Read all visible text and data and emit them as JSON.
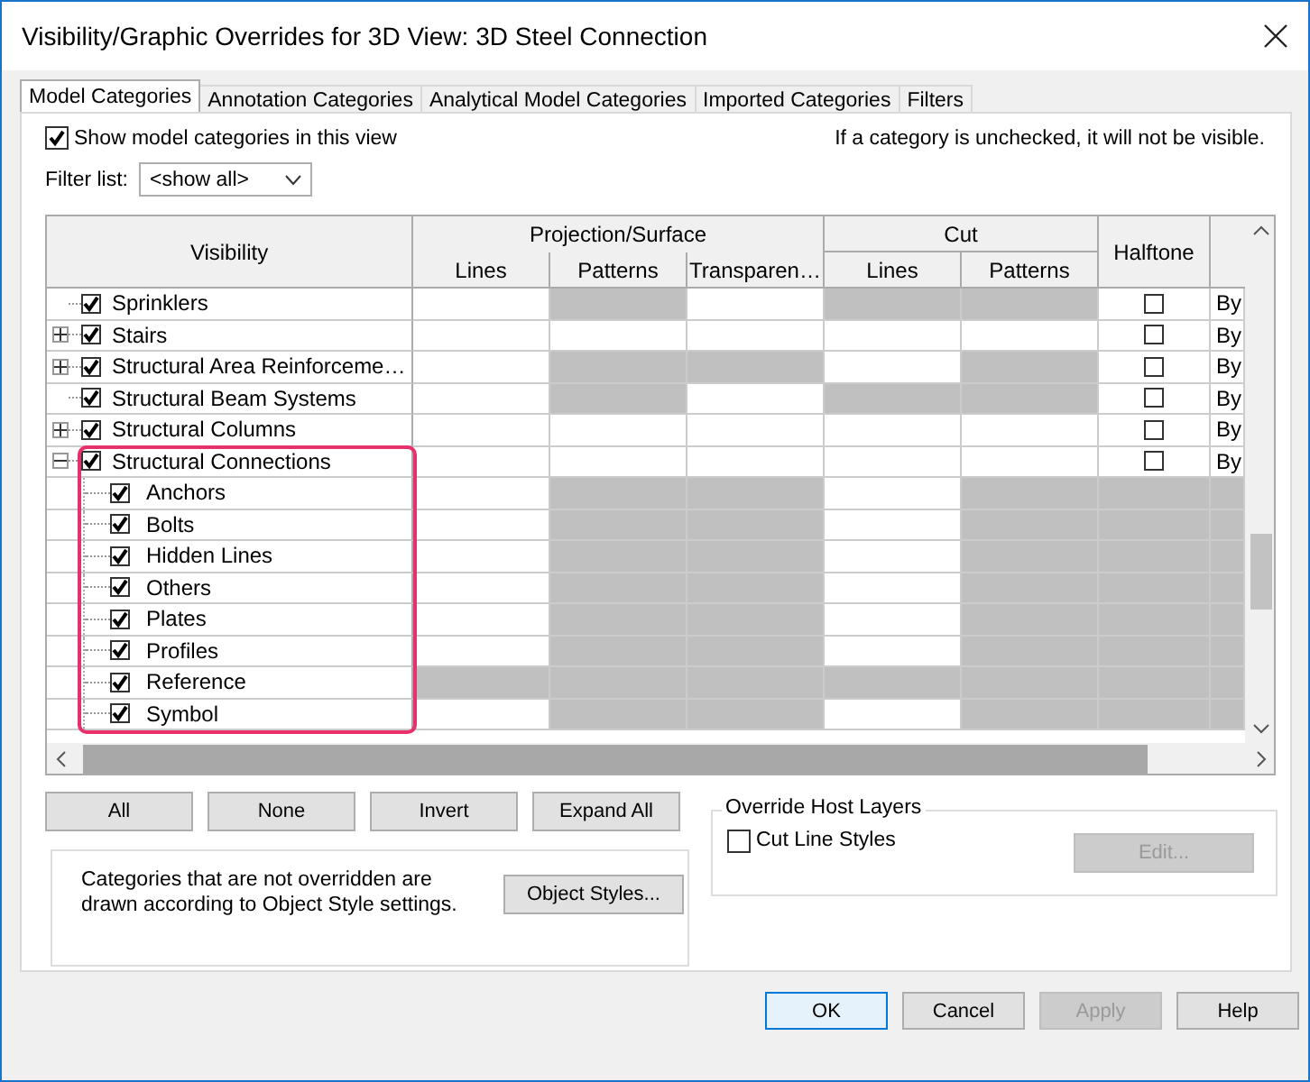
{
  "window": {
    "title": "Visibility/Graphic Overrides for 3D View: 3D Steel Connection"
  },
  "tabs": [
    {
      "label": "Model Categories",
      "selected": true
    },
    {
      "label": "Annotation Categories",
      "selected": false
    },
    {
      "label": "Analytical Model Categories",
      "selected": false
    },
    {
      "label": "Imported Categories",
      "selected": false
    },
    {
      "label": "Filters",
      "selected": false
    }
  ],
  "show_categories": {
    "label": "Show model categories in this view",
    "checked": true
  },
  "hint": "If a category is unchecked, it will not be visible.",
  "filter": {
    "label": "Filter list:",
    "value": "<show all>"
  },
  "table": {
    "columns": {
      "visibility": "Visibility",
      "projection": "Projection/Surface",
      "projection_sub": [
        "Lines",
        "Patterns",
        "Transparen…"
      ],
      "cut": "Cut",
      "cut_sub": [
        "Lines",
        "Patterns"
      ],
      "halftone": "Halftone"
    },
    "rows": [
      {
        "name": "Sprinklers",
        "checked": true,
        "expandable": false,
        "shaded": [
          false,
          true,
          false,
          true,
          true
        ],
        "halftone": false,
        "detail": "By"
      },
      {
        "name": "Stairs",
        "checked": true,
        "expandable": true,
        "expanded": false,
        "shaded": [
          false,
          false,
          false,
          false,
          false
        ],
        "halftone": false,
        "detail": "By"
      },
      {
        "name": "Structural Area Reinforceme…",
        "checked": true,
        "expandable": true,
        "expanded": false,
        "shaded": [
          false,
          true,
          true,
          false,
          true
        ],
        "halftone": false,
        "detail": "By"
      },
      {
        "name": "Structural Beam Systems",
        "checked": true,
        "expandable": false,
        "shaded": [
          false,
          true,
          false,
          true,
          true
        ],
        "halftone": false,
        "detail": "By"
      },
      {
        "name": "Structural Columns",
        "checked": true,
        "expandable": true,
        "expanded": false,
        "shaded": [
          false,
          false,
          false,
          false,
          false
        ],
        "halftone": false,
        "detail": "By"
      },
      {
        "name": "Structural Connections",
        "checked": true,
        "expandable": true,
        "expanded": true,
        "highlighted": true,
        "shaded": [
          false,
          false,
          false,
          false,
          false
        ],
        "halftone": false,
        "detail": "By",
        "children": [
          {
            "name": "Anchors",
            "checked": true,
            "shaded": [
              false,
              true,
              true,
              false,
              true
            ]
          },
          {
            "name": "Bolts",
            "checked": true,
            "shaded": [
              false,
              true,
              true,
              false,
              true
            ]
          },
          {
            "name": "Hidden Lines",
            "checked": true,
            "shaded": [
              false,
              true,
              true,
              false,
              true
            ]
          },
          {
            "name": "Others",
            "checked": true,
            "shaded": [
              false,
              true,
              true,
              false,
              true
            ]
          },
          {
            "name": "Plates",
            "checked": true,
            "shaded": [
              false,
              true,
              true,
              false,
              true
            ]
          },
          {
            "name": "Profiles",
            "checked": true,
            "shaded": [
              false,
              true,
              true,
              false,
              true
            ]
          },
          {
            "name": "Reference",
            "checked": true,
            "shaded": [
              true,
              true,
              true,
              true,
              true
            ]
          },
          {
            "name": "Symbol",
            "checked": true,
            "shaded": [
              false,
              true,
              true,
              false,
              true
            ]
          }
        ]
      }
    ]
  },
  "table_buttons": [
    "All",
    "None",
    "Invert",
    "Expand All"
  ],
  "note": {
    "text": "Categories that are not overridden are drawn according to Object Style settings.",
    "button": "Object Styles..."
  },
  "host_layers": {
    "title": "Override Host Layers",
    "checkbox": {
      "label": "Cut Line Styles",
      "checked": false
    },
    "button": {
      "label": "Edit...",
      "disabled": true
    }
  },
  "footer": [
    {
      "label": "OK",
      "disabled": false,
      "default": true
    },
    {
      "label": "Cancel",
      "disabled": false,
      "default": false
    },
    {
      "label": "Apply",
      "disabled": true,
      "default": false
    },
    {
      "label": "Help",
      "disabled": false,
      "default": false
    }
  ]
}
